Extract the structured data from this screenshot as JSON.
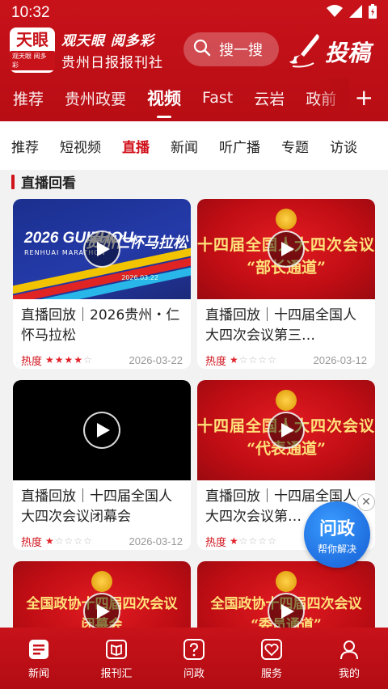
{
  "status_bar": {
    "time": "10:32"
  },
  "header": {
    "logo_big": "天眼",
    "logo_small": "观天眼 阅多彩",
    "brand_line1": "观天眼 阅多彩",
    "brand_line2": "贵州日报报刊社",
    "search_placeholder": "搜一搜",
    "submit_label": "投稿"
  },
  "channels": [
    {
      "label": "推荐",
      "active": false
    },
    {
      "label": "贵州政要",
      "active": false
    },
    {
      "label": "视频",
      "active": true
    },
    {
      "label": "Fast",
      "active": false
    },
    {
      "label": "云岩",
      "active": false
    },
    {
      "label": "政前",
      "active": false
    }
  ],
  "subtabs": [
    {
      "label": "推荐",
      "active": false
    },
    {
      "label": "短视频",
      "active": false
    },
    {
      "label": "直播",
      "active": true
    },
    {
      "label": "新闻",
      "active": false
    },
    {
      "label": "听广播",
      "active": false
    },
    {
      "label": "专题",
      "active": false
    },
    {
      "label": "访谈",
      "active": false
    }
  ],
  "section_title": "直播回看",
  "hot_label": "热度",
  "cards": [
    {
      "title": "直播回放｜2026贵州・仁怀马拉松",
      "date": "2026-03-22",
      "rating": 4,
      "thumb_text_en": "2026 GUIZHOU",
      "thumb_text_sub": "RENHUAI MARATHON",
      "thumb_text_cn": "贵州仁怀马拉松",
      "thumb_date": "2026.03.22"
    },
    {
      "title": "直播回放｜十四届全国人大四次会议第三…",
      "date": "2026-03-12",
      "rating": 1,
      "thumb_line1": "十四届全国人大四次会议",
      "thumb_line2": "“部长通道”"
    },
    {
      "title": "直播回放｜十四届全国人大四次会议闭幕会",
      "date": "2026-03-12",
      "rating": 1
    },
    {
      "title": "直播回放｜十四届全国人大四次会议第…",
      "date": "2026-03-12",
      "rating": 1,
      "thumb_line1": "十四届全国人大四次会议",
      "thumb_line2": "“代表通道”"
    },
    {
      "thumb_line1": "全国政协十四届四次会议",
      "thumb_line2": "闭幕会"
    },
    {
      "thumb_line1": "全国政协十四届四次会议",
      "thumb_line2": "“委员通道”"
    }
  ],
  "float_widget": {
    "title": "问政",
    "subtitle": "帮你解决"
  },
  "bottom_nav": [
    {
      "label": "新闻",
      "icon": "news-icon"
    },
    {
      "label": "报刊汇",
      "icon": "book-icon"
    },
    {
      "label": "问政",
      "icon": "question-icon"
    },
    {
      "label": "服务",
      "icon": "heart-service-icon"
    },
    {
      "label": "我的",
      "icon": "user-icon"
    }
  ],
  "colors": {
    "brand_red": "#c8121a",
    "active_red": "#d0121b",
    "float_blue": "#1f6fe0"
  }
}
